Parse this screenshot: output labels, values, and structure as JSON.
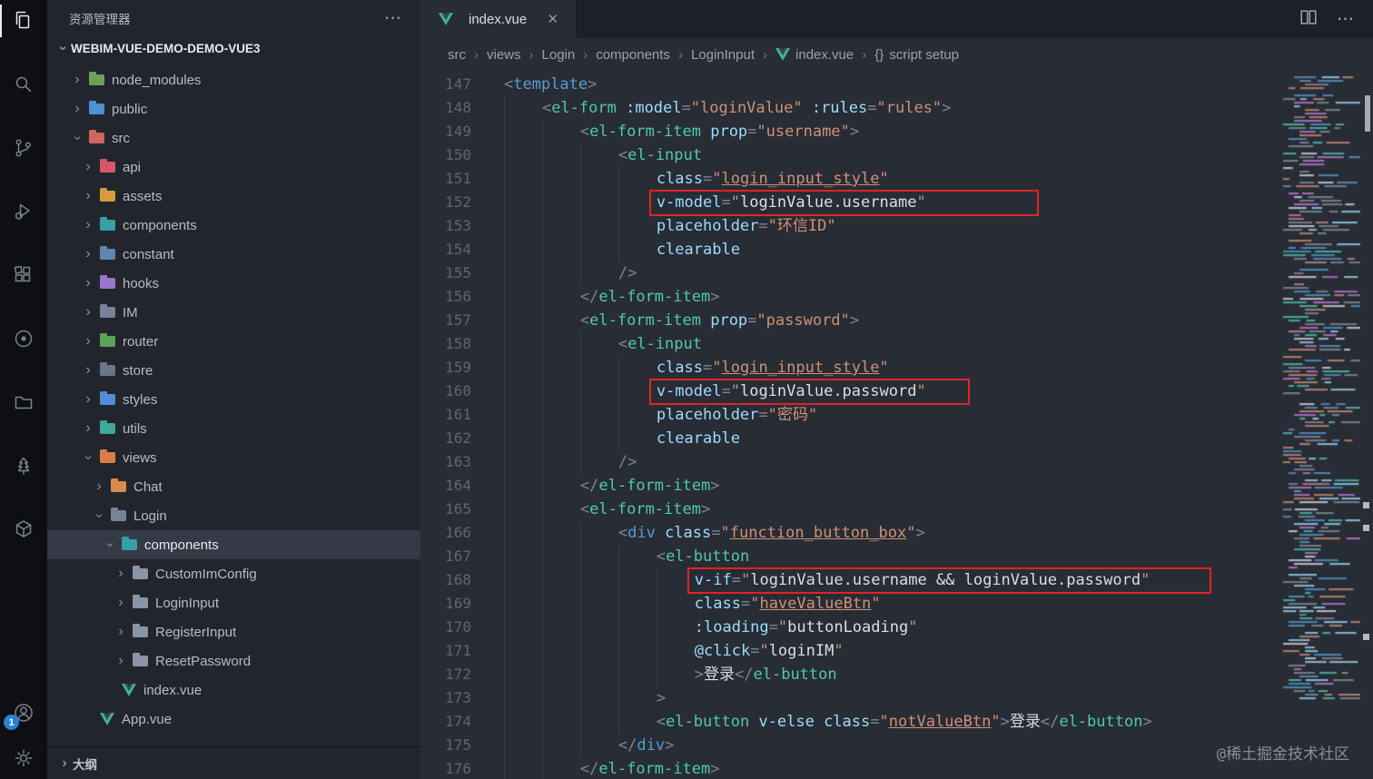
{
  "colors": {
    "annotation_red": "#e02424",
    "vue_green": "#41b883",
    "badge_blue": "#2b7fd4",
    "editor_bg": "#282c34",
    "sidebar_bg": "#22262c",
    "activitybar_bg": "#0d0f12"
  },
  "activity_bar": {
    "badge": "1",
    "icons": [
      {
        "name": "files",
        "active": true
      },
      {
        "name": "search",
        "active": false
      },
      {
        "name": "source-control",
        "active": false
      },
      {
        "name": "run-debug",
        "active": false
      },
      {
        "name": "extensions",
        "active": false
      },
      {
        "name": "record",
        "active": false
      },
      {
        "name": "folder",
        "active": false
      },
      {
        "name": "tree",
        "active": false
      },
      {
        "name": "cube",
        "active": false
      }
    ],
    "bottom_icons": [
      {
        "name": "account",
        "badge": true
      },
      {
        "name": "settings-gear",
        "badge": false
      }
    ]
  },
  "sidebar": {
    "title": "资源管理器",
    "root": "WEBIM-VUE-DEMO-DEMO-VUE3",
    "outline_label": "大纲",
    "items": [
      {
        "label": "node_modules",
        "level": 1,
        "chevron": "right",
        "icon": "folder",
        "color": "#69a25e"
      },
      {
        "label": "public",
        "level": 1,
        "chevron": "right",
        "icon": "folder",
        "color": "#4f8fd8"
      },
      {
        "label": "src",
        "level": 1,
        "chevron": "down",
        "icon": "folder",
        "color": "#cf6760"
      },
      {
        "label": "api",
        "level": 2,
        "chevron": "right",
        "icon": "folder",
        "color": "#d6566b"
      },
      {
        "label": "assets",
        "level": 2,
        "chevron": "right",
        "icon": "folder",
        "color": "#d99a3d"
      },
      {
        "label": "components",
        "level": 2,
        "chevron": "right",
        "icon": "folder",
        "color": "#35a0a5"
      },
      {
        "label": "constant",
        "level": 2,
        "chevron": "right",
        "icon": "folder",
        "color": "#5f87b0"
      },
      {
        "label": "hooks",
        "level": 2,
        "chevron": "right",
        "icon": "folder",
        "color": "#9a77cf"
      },
      {
        "label": "IM",
        "level": 2,
        "chevron": "right",
        "icon": "folder",
        "color": "#76839a"
      },
      {
        "label": "router",
        "level": 2,
        "chevron": "right",
        "icon": "folder",
        "color": "#5ca05e"
      },
      {
        "label": "store",
        "level": 2,
        "chevron": "right",
        "icon": "folder",
        "color": "#6b7689"
      },
      {
        "label": "styles",
        "level": 2,
        "chevron": "right",
        "icon": "folder",
        "color": "#4f8fd8"
      },
      {
        "label": "utils",
        "level": 2,
        "chevron": "right",
        "icon": "folder",
        "color": "#3fa79c"
      },
      {
        "label": "views",
        "level": 2,
        "chevron": "down",
        "icon": "folder",
        "color": "#d97e4a"
      },
      {
        "label": "Chat",
        "level": 3,
        "chevron": "right",
        "icon": "folder",
        "color": "#d98b4e"
      },
      {
        "label": "Login",
        "level": 3,
        "chevron": "down",
        "icon": "folder",
        "color": "#77839b"
      },
      {
        "label": "components",
        "level": 4,
        "chevron": "down",
        "icon": "folder",
        "color": "#35a0a5",
        "selected": true
      },
      {
        "label": "CustomImConfig",
        "level": 5,
        "chevron": "right",
        "icon": "folder",
        "color": "#8b95a7"
      },
      {
        "label": "LoginInput",
        "level": 5,
        "chevron": "right",
        "icon": "folder",
        "color": "#8b95a7"
      },
      {
        "label": "RegisterInput",
        "level": 5,
        "chevron": "right",
        "icon": "folder",
        "color": "#8b95a7"
      },
      {
        "label": "ResetPassword",
        "level": 5,
        "chevron": "right",
        "icon": "folder",
        "color": "#8b95a7"
      },
      {
        "label": "index.vue",
        "level": 4,
        "chevron": null,
        "icon": "vue"
      },
      {
        "label": "App.vue",
        "level": 2,
        "chevron": null,
        "icon": "vue"
      }
    ]
  },
  "editor": {
    "tab": {
      "label": "index.vue"
    },
    "breadcrumbs": [
      {
        "label": "src"
      },
      {
        "label": "views"
      },
      {
        "label": "Login"
      },
      {
        "label": "components"
      },
      {
        "label": "LoginInput"
      },
      {
        "label": "index.vue",
        "icon": "vue"
      },
      {
        "label": "script setup",
        "icon": "braces"
      }
    ],
    "watermark": "@稀土掘金技术社区",
    "code": {
      "lines": [
        {
          "n": 147,
          "i": 0,
          "tk": [
            [
              "p",
              "<"
            ],
            [
              "h",
              "template"
            ],
            [
              "p",
              ">"
            ]
          ]
        },
        {
          "n": 148,
          "i": 4,
          "tk": [
            [
              "p",
              "<"
            ],
            [
              "t",
              "el-form"
            ],
            [
              "a",
              " :model"
            ],
            [
              "p",
              "="
            ],
            [
              "s",
              "\"loginValue\""
            ],
            [
              "a",
              " :rules"
            ],
            [
              "p",
              "="
            ],
            [
              "s",
              "\"rules\""
            ],
            [
              "p",
              ">"
            ]
          ]
        },
        {
          "n": 149,
          "i": 8,
          "tk": [
            [
              "p",
              "<"
            ],
            [
              "t",
              "el-form-item"
            ],
            [
              "a",
              " prop"
            ],
            [
              "p",
              "="
            ],
            [
              "s",
              "\"username\""
            ],
            [
              "p",
              ">"
            ]
          ]
        },
        {
          "n": 150,
          "i": 12,
          "tk": [
            [
              "p",
              "<"
            ],
            [
              "t",
              "el-input"
            ]
          ]
        },
        {
          "n": 151,
          "i": 16,
          "tk": [
            [
              "a",
              "class"
            ],
            [
              "p",
              "="
            ],
            [
              "s",
              "\""
            ],
            [
              "u",
              "login_input_style"
            ],
            [
              "s",
              "\""
            ]
          ]
        },
        {
          "n": 152,
          "i": 16,
          "box": "b1",
          "tk": [
            [
              "a",
              "v-model"
            ],
            [
              "p",
              "="
            ],
            [
              "s",
              "\""
            ],
            [
              "e",
              "loginValue.username"
            ],
            [
              "s",
              "\""
            ]
          ]
        },
        {
          "n": 153,
          "i": 16,
          "tk": [
            [
              "a",
              "placeholder"
            ],
            [
              "p",
              "="
            ],
            [
              "s",
              "\"环信ID\""
            ]
          ]
        },
        {
          "n": 154,
          "i": 16,
          "tk": [
            [
              "a",
              "clearable"
            ]
          ]
        },
        {
          "n": 155,
          "i": 12,
          "tk": [
            [
              "p",
              "/>"
            ]
          ]
        },
        {
          "n": 156,
          "i": 8,
          "tk": [
            [
              "p",
              "</"
            ],
            [
              "t",
              "el-form-item"
            ],
            [
              "p",
              ">"
            ]
          ]
        },
        {
          "n": 157,
          "i": 8,
          "tk": [
            [
              "p",
              "<"
            ],
            [
              "t",
              "el-form-item"
            ],
            [
              "a",
              " prop"
            ],
            [
              "p",
              "="
            ],
            [
              "s",
              "\"password\""
            ],
            [
              "p",
              ">"
            ]
          ]
        },
        {
          "n": 158,
          "i": 12,
          "tk": [
            [
              "p",
              "<"
            ],
            [
              "t",
              "el-input"
            ]
          ]
        },
        {
          "n": 159,
          "i": 16,
          "tk": [
            [
              "a",
              "class"
            ],
            [
              "p",
              "="
            ],
            [
              "s",
              "\""
            ],
            [
              "u",
              "login_input_style"
            ],
            [
              "s",
              "\""
            ]
          ]
        },
        {
          "n": 160,
          "i": 16,
          "box": "b2",
          "tk": [
            [
              "a",
              "v-model"
            ],
            [
              "p",
              "="
            ],
            [
              "s",
              "\""
            ],
            [
              "e",
              "loginValue.password"
            ],
            [
              "s",
              "\""
            ]
          ]
        },
        {
          "n": 161,
          "i": 16,
          "tk": [
            [
              "a",
              "placeholder"
            ],
            [
              "p",
              "="
            ],
            [
              "s",
              "\"密码\""
            ]
          ]
        },
        {
          "n": 162,
          "i": 16,
          "tk": [
            [
              "a",
              "clearable"
            ]
          ]
        },
        {
          "n": 163,
          "i": 12,
          "tk": [
            [
              "p",
              "/>"
            ]
          ]
        },
        {
          "n": 164,
          "i": 8,
          "tk": [
            [
              "p",
              "</"
            ],
            [
              "t",
              "el-form-item"
            ],
            [
              "p",
              ">"
            ]
          ]
        },
        {
          "n": 165,
          "i": 8,
          "tk": [
            [
              "p",
              "<"
            ],
            [
              "t",
              "el-form-item"
            ],
            [
              "p",
              ">"
            ]
          ]
        },
        {
          "n": 166,
          "i": 12,
          "tk": [
            [
              "p",
              "<"
            ],
            [
              "h",
              "div"
            ],
            [
              "a",
              " class"
            ],
            [
              "p",
              "="
            ],
            [
              "s",
              "\""
            ],
            [
              "u",
              "function_button_box"
            ],
            [
              "s",
              "\""
            ],
            [
              "p",
              ">"
            ]
          ]
        },
        {
          "n": 167,
          "i": 16,
          "tk": [
            [
              "p",
              "<"
            ],
            [
              "t",
              "el-button"
            ]
          ]
        },
        {
          "n": 168,
          "i": 20,
          "box": "b3",
          "tk": [
            [
              "a",
              "v-if"
            ],
            [
              "p",
              "="
            ],
            [
              "s",
              "\""
            ],
            [
              "e",
              "loginValue.username && loginValue.password"
            ],
            [
              "s",
              "\""
            ]
          ]
        },
        {
          "n": 169,
          "i": 20,
          "tk": [
            [
              "a",
              "class"
            ],
            [
              "p",
              "="
            ],
            [
              "s",
              "\""
            ],
            [
              "u",
              "haveValueBtn"
            ],
            [
              "s",
              "\""
            ]
          ]
        },
        {
          "n": 170,
          "i": 20,
          "tk": [
            [
              "a",
              ":loading"
            ],
            [
              "p",
              "="
            ],
            [
              "s",
              "\""
            ],
            [
              "e",
              "buttonLoading"
            ],
            [
              "s",
              "\""
            ]
          ]
        },
        {
          "n": 171,
          "i": 20,
          "tk": [
            [
              "a",
              "@click"
            ],
            [
              "p",
              "="
            ],
            [
              "s",
              "\""
            ],
            [
              "e",
              "loginIM"
            ],
            [
              "s",
              "\""
            ]
          ]
        },
        {
          "n": 172,
          "i": 20,
          "tk": [
            [
              "p",
              ">"
            ],
            [
              "x",
              "登录"
            ],
            [
              "p",
              "</"
            ],
            [
              "t",
              "el-button"
            ]
          ]
        },
        {
          "n": 173,
          "i": 16,
          "tk": [
            [
              "p",
              ">"
            ]
          ]
        },
        {
          "n": 174,
          "i": 16,
          "tk": [
            [
              "p",
              "<"
            ],
            [
              "t",
              "el-button"
            ],
            [
              "a",
              " v-else class"
            ],
            [
              "p",
              "="
            ],
            [
              "s",
              "\""
            ],
            [
              "u",
              "notValueBtn"
            ],
            [
              "s",
              "\""
            ],
            [
              "p",
              ">"
            ],
            [
              "x",
              "登录"
            ],
            [
              "p",
              "</"
            ],
            [
              "t",
              "el-button"
            ],
            [
              "p",
              ">"
            ]
          ]
        },
        {
          "n": 175,
          "i": 12,
          "tk": [
            [
              "p",
              "</"
            ],
            [
              "h",
              "div"
            ],
            [
              "p",
              ">"
            ]
          ]
        },
        {
          "n": 176,
          "i": 8,
          "tk": [
            [
              "p",
              "</"
            ],
            [
              "t",
              "el-form-item"
            ],
            [
              "p",
              ">"
            ]
          ]
        }
      ]
    }
  }
}
